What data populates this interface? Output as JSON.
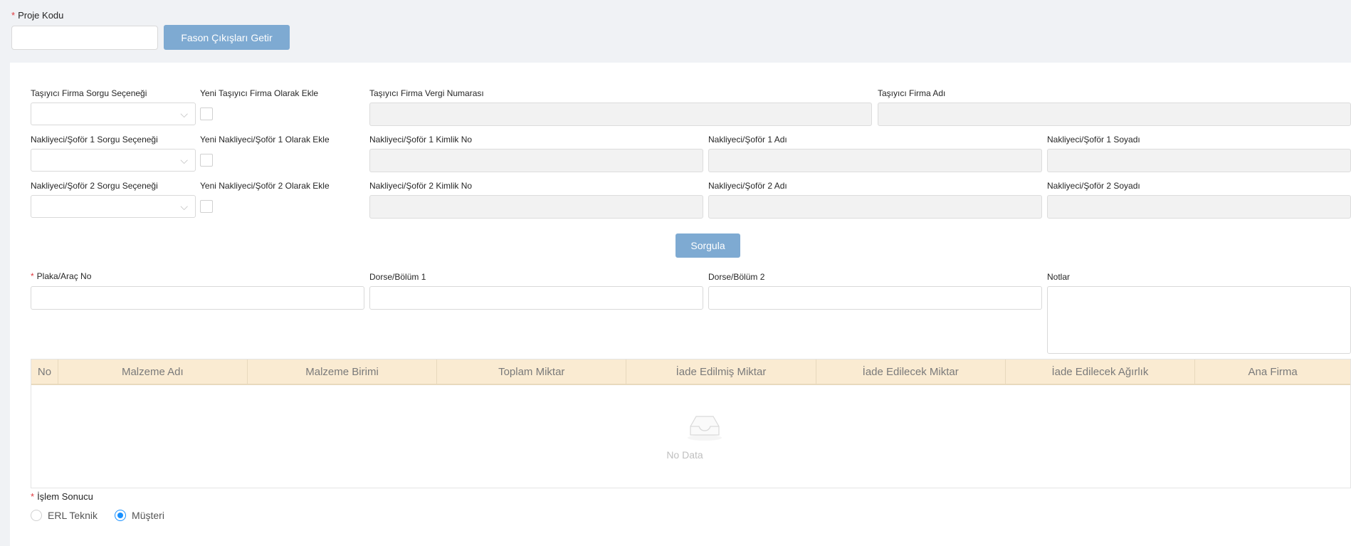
{
  "top": {
    "project_code_label": "Proje Kodu",
    "project_code_value": "",
    "fetch_button": "Fason Çıkışları Getir"
  },
  "carrier": {
    "query_option_label": "Taşıyıcı Firma Sorgu Seçeneği",
    "add_new_label": "Yeni Taşıyıcı Firma Olarak Ekle",
    "tax_no_label": "Taşıyıcı Firma Vergi Numarası",
    "name_label": "Taşıyıcı Firma Adı"
  },
  "driver1": {
    "query_option_label": "Nakliyeci/Şoför 1 Sorgu Seçeneği",
    "add_new_label": "Yeni Nakliyeci/Şoför 1 Olarak Ekle",
    "id_label": "Nakliyeci/Şoför 1 Kimlik No",
    "name_label": "Nakliyeci/Şoför 1 Adı",
    "surname_label": "Nakliyeci/Şoför 1 Soyadı"
  },
  "driver2": {
    "query_option_label": "Nakliyeci/Şoför 2 Sorgu Seçeneği",
    "add_new_label": "Yeni Nakliyeci/Şoför 2 Olarak Ekle",
    "id_label": "Nakliyeci/Şoför 2 Kimlik No",
    "name_label": "Nakliyeci/Şoför 2 Adı",
    "surname_label": "Nakliyeci/Şoför 2 Soyadı"
  },
  "query_button": "Sorgula",
  "vehicle": {
    "plate_label": "Plaka/Araç No",
    "trailer1_label": "Dorse/Bölüm 1",
    "trailer2_label": "Dorse/Bölüm 2",
    "notes_label": "Notlar"
  },
  "table": {
    "columns": [
      "No",
      "Malzeme Adı",
      "Malzeme Birimi",
      "Toplam Miktar",
      "İade Edilmiş Miktar",
      "İade Edilecek Miktar",
      "İade Edilecek Ağırlık",
      "Ana Firma"
    ],
    "empty_text": "No Data"
  },
  "result": {
    "label": "İşlem Sonucu",
    "options": [
      "ERL Teknik",
      "Müşteri"
    ],
    "selected": "Müşteri"
  },
  "icons": {
    "select_chevron": "chevron-down-icon",
    "empty": "inbox-empty-icon"
  },
  "colors": {
    "primary_button": "#7eaad2",
    "table_header": "#faebd2",
    "required": "#e0393e",
    "radio_active": "#1890ff"
  }
}
